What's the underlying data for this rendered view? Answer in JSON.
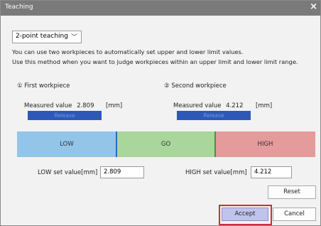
{
  "window": {
    "title": "Teaching",
    "close_glyph": "×"
  },
  "mode": {
    "selected": "2-point teaching",
    "chevron": "﹀"
  },
  "description": {
    "line1": "You can use two workpieces to automatically set upper and lower limit values.",
    "line2": "Use this method when you want to judge workpieces within an upper limit and lower limit range."
  },
  "first": {
    "heading": "① First workpiece",
    "label": "Measured value",
    "value": "2.809",
    "unit": "[mm]",
    "release": "Release"
  },
  "second": {
    "heading": "② Second workpiece",
    "label": "Measured value",
    "value": "4.212",
    "unit": "[mm]",
    "release": "Release"
  },
  "ranges": {
    "low": "LOW",
    "go": "GO",
    "high": "HIGH",
    "colors": {
      "low": "#93c5e8",
      "go": "#a9d69b",
      "high": "#e59a9c",
      "low_marker": "#1f6fbf",
      "high_marker": "#3a9a3a"
    }
  },
  "settings": {
    "low_label": "LOW set value[mm]",
    "low_value": "2.809",
    "high_label": "HIGH set value[mm]",
    "high_value": "4.212"
  },
  "buttons": {
    "reset": "Reset",
    "accept": "Accept",
    "cancel": "Cancel"
  }
}
